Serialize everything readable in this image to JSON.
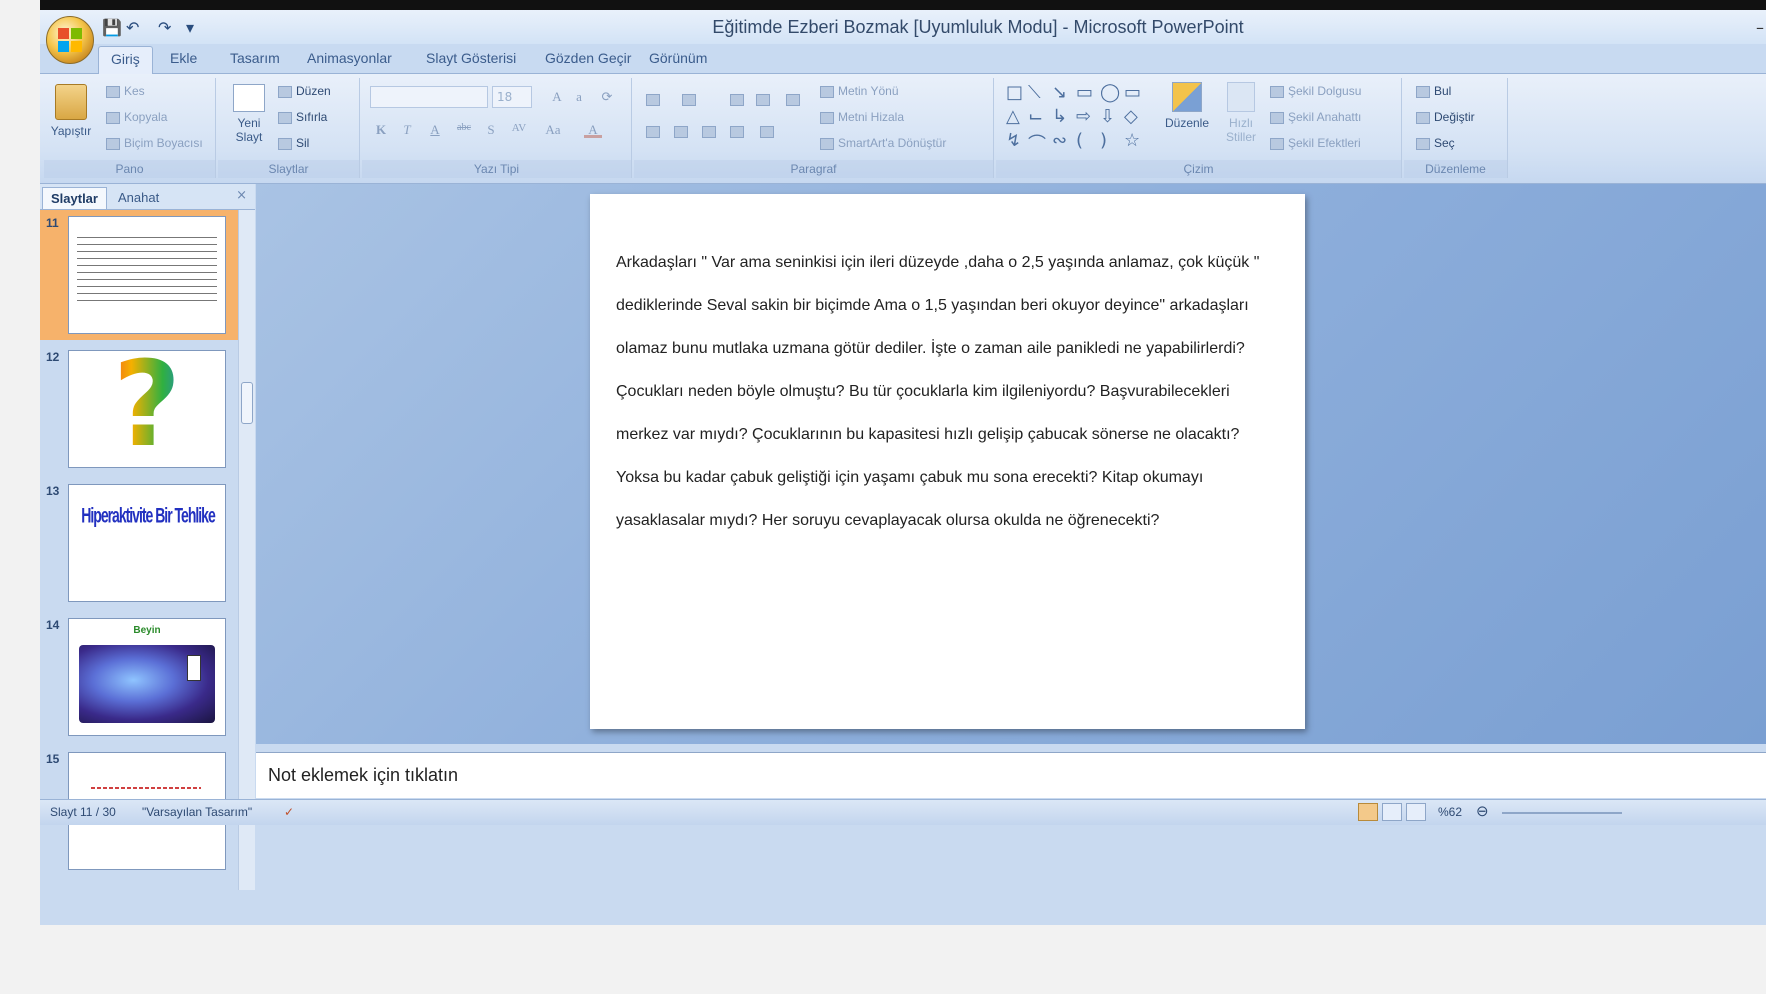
{
  "window": {
    "title": "Eğitimde Ezberi Bozmak [Uyumluluk Modu] - Microsoft PowerPoint",
    "minimize_glyph": "–"
  },
  "quick_access": {
    "save_icon": "save-icon",
    "undo_icon": "undo-icon",
    "redo_icon": "redo-icon"
  },
  "tabs": [
    "Giriş",
    "Ekle",
    "Tasarım",
    "Animasyonlar",
    "Slayt Gösterisi",
    "Gözden Geçir",
    "Görünüm"
  ],
  "ribbon": {
    "pano": {
      "label": "Pano",
      "paste": "Yapıştır",
      "cut": "Kes",
      "copy": "Kopyala",
      "format_painter": "Biçim Boyacısı"
    },
    "slaytlar": {
      "label": "Slaytlar",
      "new_slide_line1": "Yeni",
      "new_slide_line2": "Slayt",
      "layout": "Düzen",
      "reset": "Sıfırla",
      "delete": "Sil"
    },
    "yazi_tipi": {
      "label": "Yazı Tipi",
      "font_size": "18",
      "bold": "K",
      "italic": "T",
      "underline": "A",
      "strike": "abc",
      "shadow": "S",
      "spacing": "AV",
      "case": "Aa",
      "color": "A"
    },
    "paragraf": {
      "label": "Paragraf",
      "text_direction": "Metin Yönü",
      "align_text": "Metni Hizala",
      "smartart": "SmartArt'a Dönüştür"
    },
    "cizim": {
      "label": "Çizim",
      "arrange": "Düzenle",
      "quick_styles_line1": "Hızlı",
      "quick_styles_line2": "Stiller",
      "shape_fill": "Şekil Dolgusu",
      "shape_outline": "Şekil Anahattı",
      "shape_effects": "Şekil Efektleri"
    },
    "duzenleme": {
      "label": "Düzenleme",
      "find": "Bul",
      "replace": "Değiştir",
      "select": "Seç"
    }
  },
  "pane": {
    "tab_slides": "Slaytlar",
    "tab_outline": "Anahat",
    "close": "×",
    "thumbnails": [
      {
        "number": "11",
        "selected": true
      },
      {
        "number": "12",
        "selected": false
      },
      {
        "number": "13",
        "selected": false,
        "title": "Hiperaktivite Bir Tehlike"
      },
      {
        "number": "14",
        "selected": false,
        "title": "Beyin"
      },
      {
        "number": "15",
        "selected": false
      }
    ]
  },
  "slide": {
    "text": "Arkadaşları \" Var ama seninkisi için ileri düzeyde ,daha o 2,5 yaşında anlamaz, çok küçük \" dediklerinde Seval sakin bir biçimde Ama o 1,5 yaşından beri okuyor deyince\" arkadaşları olamaz bunu mutlaka uzmana götür dediler. İşte o zaman aile panikledi ne yapabilirlerdi? Çocukları neden böyle olmuştu? Bu tür çocuklarla kim ilgileniyordu? Başvurabilecekleri merkez var mıydı? Çocuklarının bu kapasitesi hızlı gelişip çabucak sönerse ne olacaktı? Yoksa bu kadar çabuk geliştiği için yaşamı çabuk mu sona erecekti? Kitap okumayı yasaklasalar mıydı? Her soruyu cevaplayacak olursa okulda ne öğrenecekti?"
  },
  "notes": {
    "placeholder": "Not eklemek için tıklatın"
  },
  "status": {
    "slide_counter": "Slayt 11 / 30",
    "theme": "\"Varsayılan Tasarım\"",
    "zoom": "%62"
  }
}
